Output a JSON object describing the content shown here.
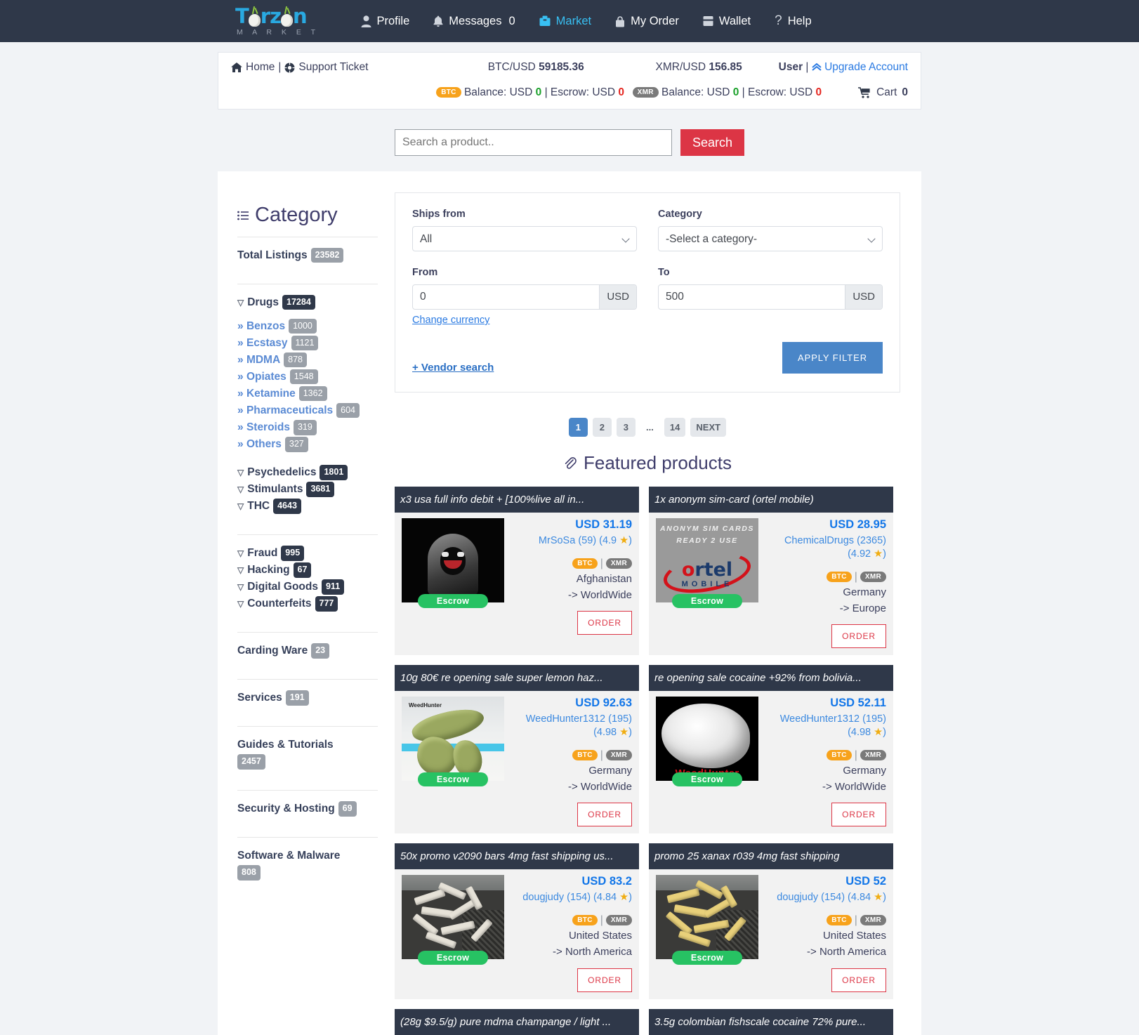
{
  "navbar": {
    "logo_main": "T rz n",
    "logo_sub": "M A R K E T",
    "items": [
      {
        "label": "Profile",
        "icon": "user-icon",
        "count": ""
      },
      {
        "label": "Messages",
        "icon": "bell-icon",
        "count": "0"
      },
      {
        "label": "Market",
        "icon": "store-icon",
        "count": "",
        "active": true
      },
      {
        "label": "My Order",
        "icon": "bag-icon",
        "count": ""
      },
      {
        "label": "Wallet",
        "icon": "wallet-icon",
        "count": ""
      },
      {
        "label": "Help",
        "icon": "question-icon",
        "count": ""
      }
    ]
  },
  "info": {
    "home": "Home",
    "separator": "|",
    "support": "Support Ticket",
    "btc_label": "BTC/USD",
    "btc_rate": "59185.36",
    "xmr_label": "XMR/USD",
    "xmr_rate": "156.85",
    "user": "User",
    "upgrade": "Upgrade Account",
    "btc_pill": "BTC",
    "xmr_pill": "XMR",
    "balance_label": "Balance: USD",
    "balance_value": "0",
    "escrow_label": "Escrow: USD",
    "escrow_value": "0",
    "cart_label": "Cart",
    "cart_count": "0"
  },
  "search": {
    "placeholder": "Search a product..",
    "value": "",
    "button": "Search"
  },
  "sidebar": {
    "title": "Category",
    "total_label": "Total Listings",
    "total_count": "23582",
    "groups": [
      {
        "label": "Drugs",
        "count": "17284",
        "dark": true,
        "children": [
          {
            "label": "Benzos",
            "count": "1000"
          },
          {
            "label": "Ecstasy",
            "count": "1121"
          },
          {
            "label": "MDMA",
            "count": "878"
          },
          {
            "label": "Opiates",
            "count": "1548"
          },
          {
            "label": "Ketamine",
            "count": "1362"
          },
          {
            "label": "Pharmaceuticals",
            "count": "604"
          },
          {
            "label": "Steroids",
            "count": "319"
          },
          {
            "label": "Others",
            "count": "327"
          }
        ]
      },
      {
        "label": "Psychedelics",
        "count": "1801",
        "dark": true,
        "children": []
      },
      {
        "label": "Stimulants",
        "count": "3681",
        "dark": true,
        "children": []
      },
      {
        "label": "THC",
        "count": "4643",
        "dark": true,
        "children": []
      }
    ],
    "groups2": [
      {
        "label": "Fraud",
        "count": "995",
        "dark": true
      },
      {
        "label": "Hacking",
        "count": "67",
        "dark": true
      },
      {
        "label": "Digital Goods",
        "count": "911",
        "dark": true
      },
      {
        "label": "Counterfeits",
        "count": "777",
        "dark": true
      }
    ],
    "plain": [
      {
        "label": "Carding Ware",
        "count": "23"
      },
      {
        "label": "Services",
        "count": "191"
      },
      {
        "label": "Guides & Tutorials",
        "count": "2457"
      },
      {
        "label": "Security & Hosting",
        "count": "69"
      },
      {
        "label": "Software & Malware",
        "count": "808"
      }
    ]
  },
  "filter": {
    "ships_from_label": "Ships from",
    "ships_from_value": "All",
    "category_label": "Category",
    "category_value": "-Select a category-",
    "from_label": "From",
    "from_value": "0",
    "from_unit": "USD",
    "to_label": "To",
    "to_value": "500",
    "to_unit": "USD",
    "change_currency": "Change currency",
    "vendor_search": "+ Vendor search",
    "apply": "APPLY FILTER"
  },
  "pagination": {
    "pages": [
      "1",
      "2",
      "3",
      "...",
      "14"
    ],
    "active": "1",
    "next": "NEXT"
  },
  "featured": {
    "title": "Featured products",
    "icon": "paperclip-icon"
  },
  "products": [
    {
      "title": "x3 usa full info debit + [100%live all in...",
      "price": "USD 31.19",
      "vendor": "MrSoSa (59) (4.9",
      "rating_close": ")",
      "coins": [
        "BTC",
        "XMR"
      ],
      "from": "Afghanistan",
      "to": "-> WorldWide",
      "escrow": "Escrow",
      "order": "ORDER",
      "art": "hacker"
    },
    {
      "title": "1x anonym sim-card (ortel mobile)",
      "price": "USD 28.95",
      "vendor": "ChemicalDrugs (2365) (4.92",
      "rating_close": ")",
      "coins": [
        "BTC",
        "XMR"
      ],
      "from": "Germany",
      "to": "-> Europe",
      "escrow": "Escrow",
      "order": "ORDER",
      "art": "ortel",
      "art_text1": "ANONYM SIM CARDS",
      "art_text2": "READY 2 USE",
      "art_brand_r": "o",
      "art_brand_b": "rtel",
      "art_brand_sub": "MOBILE"
    },
    {
      "title": "10g 80€ re opening sale super lemon haz...",
      "price": "USD 92.63",
      "vendor": "WeedHunter1312 (195) (4.98",
      "rating_close": ")",
      "coins": [
        "BTC",
        "XMR"
      ],
      "from": "Germany",
      "to": "-> WorldWide",
      "escrow": "Escrow",
      "order": "ORDER",
      "art": "weed",
      "art_watermark": "WeedHunter"
    },
    {
      "title": "re opening sale cocaine +92% from bolivia...",
      "price": "USD 52.11",
      "vendor": "WeedHunter1312 (195) (4.98",
      "rating_close": ")",
      "coins": [
        "BTC",
        "XMR"
      ],
      "from": "Germany",
      "to": "-> WorldWide",
      "escrow": "Escrow",
      "order": "ORDER",
      "art": "coke",
      "art_watermark": "WeedHunter"
    },
    {
      "title": "50x promo v2090 bars 4mg fast shipping us...",
      "price": "USD 83.2",
      "vendor": "dougjudy (154) (4.84",
      "rating_close": ")",
      "coins": [
        "BTC",
        "XMR"
      ],
      "from": "United States",
      "to": "-> North America",
      "escrow": "Escrow",
      "order": "ORDER",
      "art": "bars-white"
    },
    {
      "title": "promo 25 xanax r039 4mg fast shipping",
      "price": "USD 52",
      "vendor": "dougjudy (154) (4.84",
      "rating_close": ")",
      "coins": [
        "BTC",
        "XMR"
      ],
      "from": "United States",
      "to": "-> North America",
      "escrow": "Escrow",
      "order": "ORDER",
      "art": "bars-yellow"
    },
    {
      "title": "(28g $9.5/g) pure mdma champange / light ...",
      "price": "",
      "vendor": "",
      "rating_close": "",
      "coins": [],
      "from": "",
      "to": "",
      "escrow": "",
      "order": "",
      "art": "none"
    },
    {
      "title": "3.5g colombian fishscale cocaine 72% pure...",
      "price": "",
      "vendor": "",
      "rating_close": "",
      "coins": [],
      "from": "",
      "to": "",
      "escrow": "",
      "order": "",
      "art": "none"
    }
  ]
}
